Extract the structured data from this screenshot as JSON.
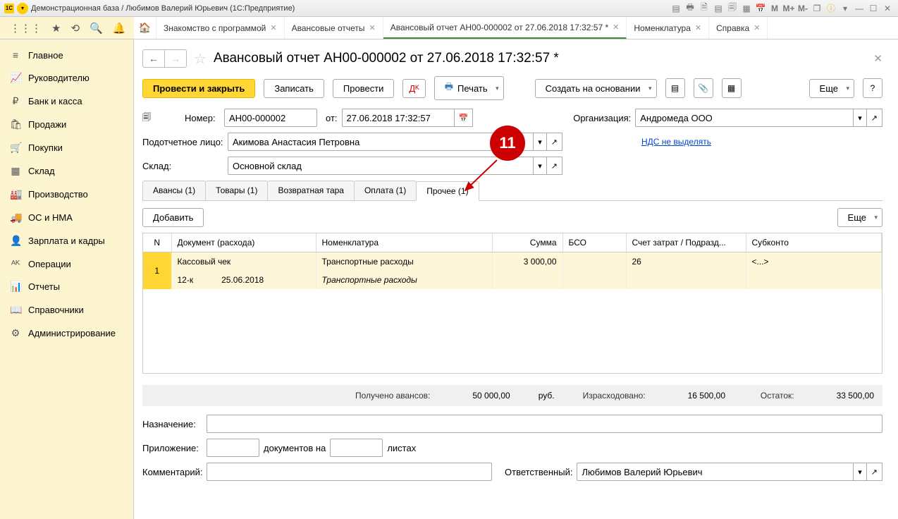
{
  "titlebar": {
    "logo": "1С",
    "title": "Демонстрационная база / Любимов Валерий Юрьевич (1С:Предприятие)"
  },
  "topicons": [
    "☰",
    "★",
    "⟲",
    "🔍",
    "🔔"
  ],
  "tabs": [
    {
      "label": "Знакомство с программой",
      "active": false
    },
    {
      "label": "Авансовые отчеты",
      "active": false
    },
    {
      "label": "Авансовый отчет АН00-000002 от 27.06.2018 17:32:57 *",
      "active": true
    },
    {
      "label": "Номенклатура",
      "active": false
    },
    {
      "label": "Справка",
      "active": false
    }
  ],
  "sidebar": [
    {
      "icon": "≡",
      "label": "Главное"
    },
    {
      "icon": "📈",
      "label": "Руководителю"
    },
    {
      "icon": "₽",
      "label": "Банк и касса"
    },
    {
      "icon": "🛍",
      "label": "Продажи"
    },
    {
      "icon": "🛒",
      "label": "Покупки"
    },
    {
      "icon": "▦",
      "label": "Склад"
    },
    {
      "icon": "🏭",
      "label": "Производство"
    },
    {
      "icon": "🚚",
      "label": "ОС и НМА"
    },
    {
      "icon": "👤",
      "label": "Зарплата и кадры"
    },
    {
      "icon": "ᴬᴷ",
      "label": "Операции"
    },
    {
      "icon": "📊",
      "label": "Отчеты"
    },
    {
      "icon": "📖",
      "label": "Справочники"
    },
    {
      "icon": "⚙",
      "label": "Администрирование"
    }
  ],
  "page": {
    "title": "Авансовый отчет АН00-000002 от 27.06.2018 17:32:57 *"
  },
  "actions": {
    "primary": "Провести и закрыть",
    "save": "Записать",
    "post": "Провести",
    "print": "Печать",
    "create_based": "Создать на основании",
    "more": "Еще"
  },
  "form": {
    "number_label": "Номер:",
    "number": "АН00-000002",
    "from_label": "от:",
    "date": "27.06.2018 17:32:57",
    "org_label": "Организация:",
    "org": "Андромеда ООО",
    "person_label": "Подотчетное лицо:",
    "person": "Акимова Анастасия Петровна",
    "nds_link": "НДС не выделять",
    "warehouse_label": "Склад:",
    "warehouse": "Основной склад"
  },
  "subtabs": [
    {
      "label": "Авансы (1)"
    },
    {
      "label": "Товары (1)"
    },
    {
      "label": "Возвратная тара"
    },
    {
      "label": "Оплата (1)"
    },
    {
      "label": "Прочее (1)",
      "active": true
    }
  ],
  "table_actions": {
    "add": "Добавить",
    "more": "Еще"
  },
  "columns": [
    "N",
    "Документ (расхода)",
    "Номенклатура",
    "Сумма",
    "БСО",
    "Счет затрат / Подразд...",
    "Субконто"
  ],
  "rows": [
    {
      "n": "1",
      "doc": "Кассовый чек",
      "nom": "Транспортные расходы",
      "sum": "3 000,00",
      "bso": "",
      "account": "26",
      "subconto": "<...>"
    },
    {
      "doc": "12-к",
      "date": "25.06.2018",
      "nom": "Транспортные расходы"
    }
  ],
  "summary": {
    "received_label": "Получено авансов:",
    "received": "50 000,00",
    "currency": "руб.",
    "spent_label": "Израсходовано:",
    "spent": "16 500,00",
    "balance_label": "Остаток:",
    "balance": "33 500,00"
  },
  "footer": {
    "purpose_label": "Назначение:",
    "attach_label": "Приложение:",
    "docs_on": "документов на",
    "sheets": "листах",
    "comment_label": "Комментарий:",
    "responsible_label": "Ответственный:",
    "responsible": "Любимов Валерий Юрьевич"
  },
  "callout": {
    "number": "11"
  }
}
